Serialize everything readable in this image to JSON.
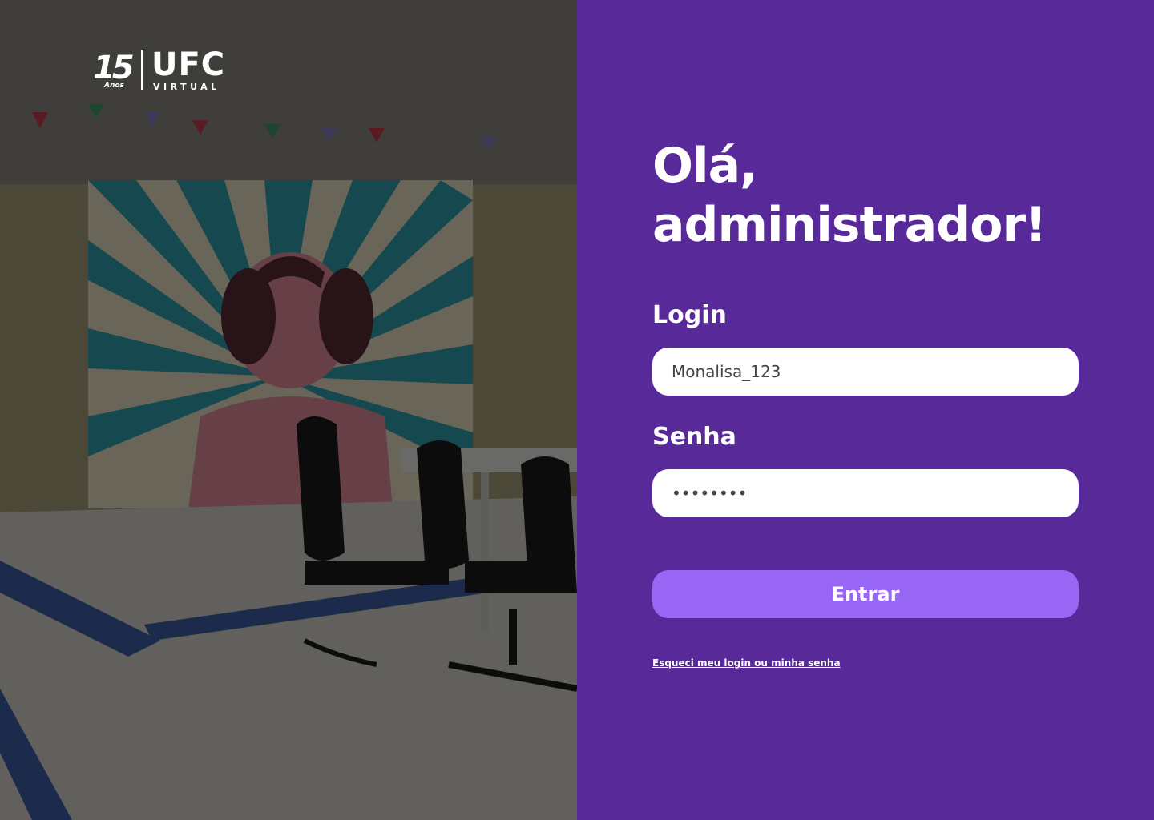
{
  "brand": {
    "years_number": "15",
    "years_word": "Anos",
    "name": "UFC",
    "subtitle": "VIRTUAL"
  },
  "login_form": {
    "greeting": "Olá, administrador!",
    "login_label": "Login",
    "login_value": "Monalisa_123",
    "password_label": "Senha",
    "password_value": "********",
    "submit_label": "Entrar",
    "forgot_link": "Esqueci meu login ou minha senha"
  },
  "colors": {
    "panel_background": "#572999",
    "button_background": "#9866f5",
    "input_background": "#ffffff"
  }
}
